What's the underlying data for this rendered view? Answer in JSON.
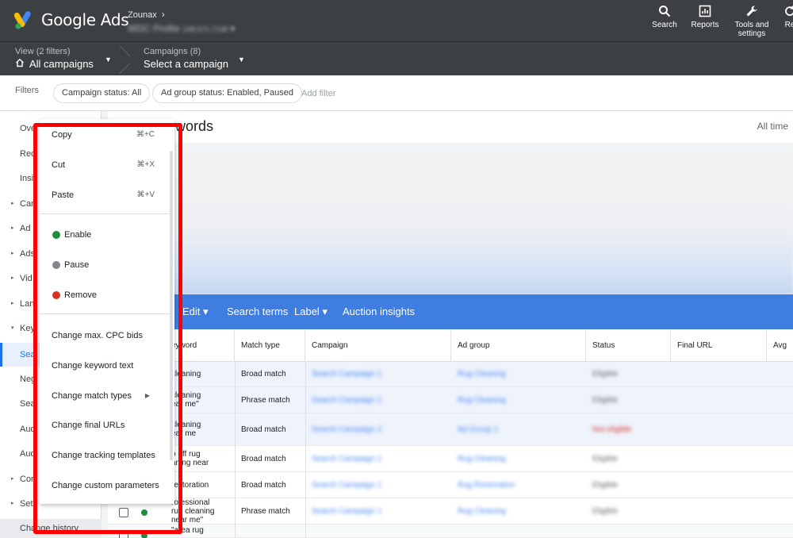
{
  "app": {
    "name": "Google Ads"
  },
  "account": {
    "name": "Zounax",
    "profile": "WDC Profile",
    "id": "248-571-7148"
  },
  "tools": [
    {
      "label": "Search",
      "icon": "search-icon"
    },
    {
      "label": "Reports",
      "icon": "reports-icon"
    },
    {
      "label": "Tools and\nsettings",
      "icon": "wrench-icon"
    },
    {
      "label": "Re",
      "icon": "refresh-icon"
    }
  ],
  "subbar": {
    "view_small": "View (2 filters)",
    "view_big": "All campaigns",
    "campaigns_small": "Campaigns (8)",
    "campaigns_big": "Select a campaign"
  },
  "filters": {
    "label": "Filters",
    "chips": [
      "Campaign status: All",
      "Ad group status: Enabled, Paused"
    ],
    "add": "Add filter"
  },
  "nav": {
    "items": [
      {
        "label": "Ove",
        "tri": ""
      },
      {
        "label": "Rec",
        "tri": ""
      },
      {
        "label": "Insi",
        "tri": ""
      },
      {
        "label": "Car",
        "tri": "▸"
      },
      {
        "label": "Ad",
        "tri": "▸"
      },
      {
        "label": "Ads",
        "tri": "▸"
      },
      {
        "label": "Vid",
        "tri": "▸"
      },
      {
        "label": "Lan",
        "tri": "▸"
      },
      {
        "label": "Key",
        "tri": "▾"
      },
      {
        "label": "Sea",
        "tri": ""
      },
      {
        "label": "Neg",
        "tri": ""
      },
      {
        "label": "Sea",
        "tri": ""
      },
      {
        "label": "Aud",
        "tri": ""
      },
      {
        "label": "Aud",
        "tri": ""
      },
      {
        "label": "Cor",
        "tri": "▸"
      },
      {
        "label": "Set",
        "tri": "▸"
      }
    ],
    "footer": "Change history"
  },
  "page": {
    "title": "Search keywords",
    "title_visible": "ywords",
    "range": "All time"
  },
  "actions": {
    "edit": "Edit ▾",
    "search_terms": "Search terms",
    "label": "Label ▾",
    "auction": "Auction insights"
  },
  "table": {
    "headers": [
      "eyword",
      "Match type",
      "Campaign",
      "Ad group",
      "Status",
      "Final URL",
      "Avg"
    ],
    "rows": [
      {
        "keyword": "cleaning",
        "match": "Broad match",
        "campaign": "Search Campaign 1",
        "adgroup": "Rug Cleaning",
        "status": "Eligible"
      },
      {
        "keyword": "cleaning\near me\"",
        "match": "Phrase match",
        "campaign": "Search Campaign 1",
        "adgroup": "Rug Cleaning",
        "status": "Eligible"
      },
      {
        "keyword": "cleaning\near me",
        "match": "Broad match",
        "campaign": "Search Campaign 2",
        "adgroup": "Ad Group 1",
        "status": "Not eligible"
      },
      {
        "keyword": "o off rug\naning near",
        "match": "Broad match",
        "campaign": "Search Campaign 1",
        "adgroup": "Rug Cleaning",
        "status": "Eligible"
      },
      {
        "keyword": "restoration",
        "match": "Broad match",
        "campaign": "Search Campaign 1",
        "adgroup": "Rug Restoration",
        "status": "Eligible"
      },
      {
        "keyword": "rofessional\nrug cleaning\nnear me\"",
        "match": "Phrase match",
        "campaign": "Search Campaign 1",
        "adgroup": "Rug Cleaning",
        "status": "Eligible"
      },
      {
        "keyword": "\"area rug",
        "match": "",
        "campaign": "",
        "adgroup": "",
        "status": ""
      }
    ]
  },
  "menu": {
    "copy": "Copy",
    "copy_sc": "⌘+C",
    "cut": "Cut",
    "cut_sc": "⌘+X",
    "paste": "Paste",
    "paste_sc": "⌘+V",
    "enable": "Enable",
    "pause": "Pause",
    "remove": "Remove",
    "cpc": "Change max. CPC bids",
    "kwtext": "Change keyword text",
    "matchtypes": "Change match types",
    "finalurls": "Change final URLs",
    "tracking": "Change tracking templates",
    "custom": "Change custom parameters"
  },
  "colors": {
    "header": "#3c4043",
    "accent": "#1a73e8",
    "action_bar": "#3f7de0",
    "enable": "#1e8e3e",
    "pause": "#80868b",
    "remove": "#d93025",
    "highlight": "#ff0000"
  }
}
